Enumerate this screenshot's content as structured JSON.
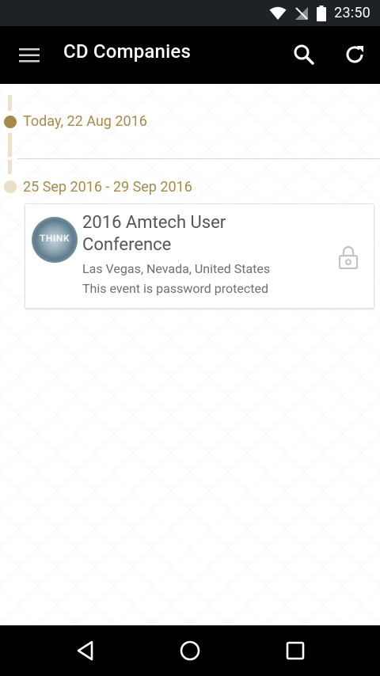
{
  "status_bar": {
    "time": "23:50",
    "icons": [
      "wifi-icon",
      "no-signal-icon",
      "battery-icon"
    ]
  },
  "app_bar": {
    "title": "CD Companies",
    "icons": [
      "menu-icon",
      "search-icon",
      "refresh-icon"
    ]
  },
  "timeline": {
    "today_label": "Today, 22 Aug 2016",
    "groups": [
      {
        "date_range": "25 Sep 2016 - 29 Sep 2016",
        "events": [
          {
            "title": "2016 Amtech User Conference",
            "location": "Las Vegas, Nevada, United States",
            "note": "This event is password protected",
            "avatar_text": "THINK",
            "icon": "lock-icon"
          }
        ]
      }
    ]
  },
  "colors": {
    "accent": "#a88a4b",
    "today_dot": "#a8894a",
    "future_dot": "#e9dfc9",
    "appbar": "#000000",
    "statusbar": "#1e2227"
  },
  "nav_bar": {
    "icons": [
      "back-icon",
      "home-icon",
      "recents-icon"
    ]
  }
}
